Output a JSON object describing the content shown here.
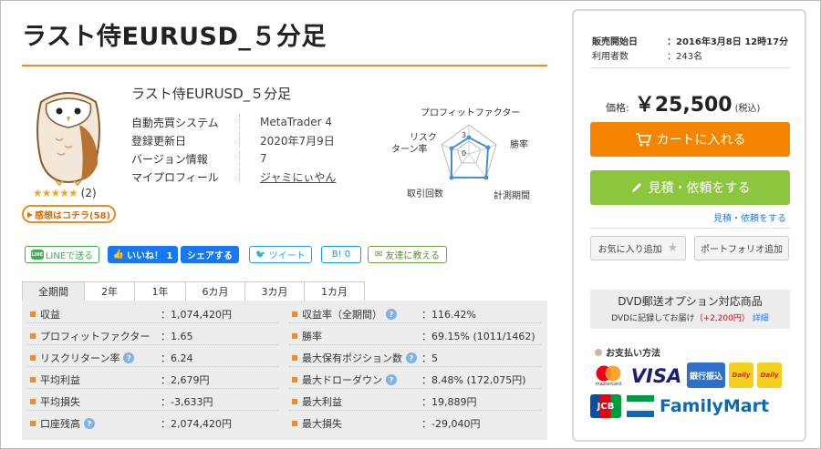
{
  "product": {
    "title": "ラスト侍EURUSD_５分足",
    "subtitle": "ラスト侍EURUSD_５分足",
    "rating_stars": "★★★★★",
    "rating_count": "(2)",
    "review_button": "感想はコチラ(58)",
    "info": [
      {
        "key": "自動売買システム",
        "value": "MetaTrader 4"
      },
      {
        "key": "登録更新日",
        "value": "2020年7月9日"
      },
      {
        "key": "バージョン情報",
        "value": "7"
      },
      {
        "key": "マイプロフィール",
        "value": "ジャミにぃやん"
      }
    ]
  },
  "radar": {
    "labels": {
      "profit_factor": "プロフィットファクター",
      "risk_return_1": "リスク",
      "risk_return_2": "ターン率",
      "win_rate": "勝率",
      "trades": "取引回数",
      "period": "計測期間"
    },
    "scale_outer": "3",
    "scale_inner": "0"
  },
  "social": {
    "line": "LINEで送る",
    "line_logo": "LINE",
    "fb_like": "いいね！ 1",
    "fb_share": "シェアする",
    "tweet": "ツイート",
    "hatena": "B! 0",
    "friend": "友達に教える"
  },
  "tabs": [
    "全期間",
    "2年",
    "1年",
    "6カ月",
    "3カ月",
    "1カ月"
  ],
  "stats_left": [
    {
      "label": "収益",
      "value": "：1,074,420円",
      "help": false
    },
    {
      "label": "プロフィットファクター",
      "value": "：1.65",
      "help": false
    },
    {
      "label": "リスクリターン率",
      "value": "：6.24",
      "help": true
    },
    {
      "label": "平均利益",
      "value": "：2,679円",
      "help": false
    },
    {
      "label": "平均損失",
      "value": "：-3,633円",
      "help": false
    },
    {
      "label": "口座残高",
      "value": "：2,074,420円",
      "help": true
    }
  ],
  "stats_right": [
    {
      "label": "収益率（全期間）",
      "value": "：116.42%",
      "help": true
    },
    {
      "label": "勝率",
      "value": "：69.15% (1011/1462)",
      "help": false
    },
    {
      "label": "最大保有ポジション数",
      "value": "：5",
      "help": true
    },
    {
      "label": "最大ドローダウン",
      "value": "：8.48% (172,075円)",
      "help": true
    },
    {
      "label": "最大利益",
      "value": "：19,889円",
      "help": false
    },
    {
      "label": "最大損失",
      "value": "：-29,040円",
      "help": false
    }
  ],
  "help_mark": "?",
  "sidebar": {
    "sale_start_label": "販売開始日",
    "sale_start_value": "：2016年3月8日 12時17分",
    "users_label": "利用者数",
    "users_value": "：243名",
    "price_label": "価格:",
    "price_value": "￥25,500",
    "price_tax": "(税込)",
    "cart_button": "カートに入れる",
    "estimate_button": "見積・依頼をする",
    "estimate_link": "見積・依頼をする",
    "fav_button": "お気に入り追加",
    "portfolio_button": "ポートフォリオ追加",
    "dvd_title": "DVD郵送オプション対応商品",
    "dvd_text": "DVDに記録してお届け",
    "dvd_price": "（+2,200円）",
    "dvd_link": "詳細",
    "pay_title": "お支払い方法",
    "pay": {
      "mastercard": "mastercard",
      "visa": "VISA",
      "bank": "銀行振込",
      "daily": "Daily",
      "jcb": "JCB",
      "familymart": "FamilyMart"
    }
  }
}
